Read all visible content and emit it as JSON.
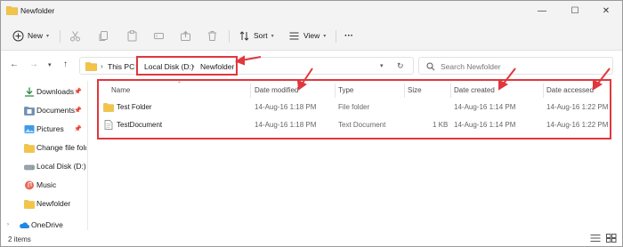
{
  "window": {
    "title": "Newfolder"
  },
  "controls": {
    "minimize": "—",
    "maximize": "☐",
    "close": "✕"
  },
  "command_bar": {
    "new_label": "New",
    "sort_label": "Sort",
    "view_label": "View",
    "more_label": "···"
  },
  "address_bar": {
    "crumbs": [
      "This PC",
      "Local Disk (D:)",
      "Newfolder"
    ]
  },
  "search": {
    "placeholder": "Search Newfolder"
  },
  "sidebar": {
    "items": [
      {
        "label": "Downloads",
        "icon": "download-icon",
        "pinned": true
      },
      {
        "label": "Documents",
        "icon": "document-folder-icon",
        "pinned": true
      },
      {
        "label": "Pictures",
        "icon": "pictures-icon",
        "pinned": true
      },
      {
        "label": "Change file fold",
        "icon": "folder-icon",
        "pinned": false
      },
      {
        "label": "Local Disk (D:)",
        "icon": "drive-icon",
        "pinned": false
      },
      {
        "label": "Music",
        "icon": "music-icon",
        "pinned": false
      },
      {
        "label": "Newfolder",
        "icon": "folder-icon",
        "pinned": false
      },
      {
        "label": "OneDrive",
        "icon": "cloud-icon",
        "pinned": false
      }
    ]
  },
  "table": {
    "headers": {
      "name": "Name",
      "date_modified": "Date modified",
      "type": "Type",
      "size": "Size",
      "date_created": "Date created",
      "date_accessed": "Date accessed"
    },
    "rows": [
      {
        "name": "Test Folder",
        "date_modified": "14-Aug-16 1:18 PM",
        "type": "File folder",
        "size": "",
        "date_created": "14-Aug-16 1:14 PM",
        "date_accessed": "14-Aug-16 1:22 PM",
        "icon": "folder-icon"
      },
      {
        "name": "TestDocument",
        "date_modified": "14-Aug-16 1:18 PM",
        "type": "Text Document",
        "size": "1 KB",
        "date_created": "14-Aug-16 1:14 PM",
        "date_accessed": "14-Aug-16 1:22 PM",
        "icon": "text-document-icon"
      }
    ]
  },
  "status": {
    "items_count": "2 items"
  },
  "colors": {
    "accent": "#0067c0",
    "annotation": "#e0373d",
    "folder": "#f4c544"
  }
}
